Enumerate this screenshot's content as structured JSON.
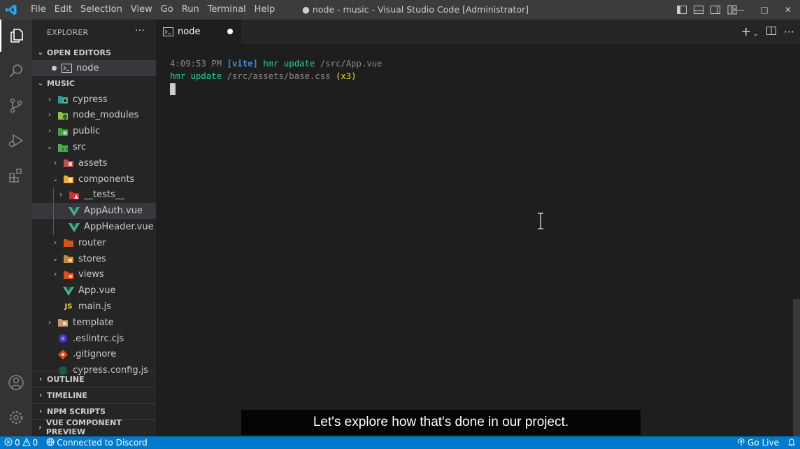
{
  "titlebar": {
    "logo_icon": "vscode-logo",
    "menu": [
      "File",
      "Edit",
      "Selection",
      "View",
      "Go",
      "Run",
      "Terminal",
      "Help"
    ],
    "window_title": "● node - music - Visual Studio Code [Administrator]"
  },
  "activity_bar": [
    "explorer-icon",
    "search-icon",
    "source-control-icon",
    "run-debug-icon",
    "extensions-icon",
    "accounts-icon",
    "manage-gear-icon"
  ],
  "sidebar": {
    "title": "EXPLORER",
    "more": "···",
    "open_editors": {
      "title": "OPEN EDITORS",
      "items": [
        {
          "label": "node",
          "icon": "terminal-icon"
        }
      ]
    },
    "folder": {
      "title": "MUSIC",
      "items": [
        {
          "label": "cypress"
        },
        {
          "label": "node_modules"
        },
        {
          "label": "public"
        },
        {
          "label": "src"
        },
        {
          "label": "assets"
        },
        {
          "label": "components"
        },
        {
          "label": "__tests__"
        },
        {
          "label": "AppAuth.vue"
        },
        {
          "label": "AppHeader.vue"
        },
        {
          "label": "router"
        },
        {
          "label": "stores"
        },
        {
          "label": "views"
        },
        {
          "label": "App.vue"
        },
        {
          "label": "main.js"
        },
        {
          "label": "template"
        },
        {
          "label": ".eslintrc.cjs"
        },
        {
          "label": ".gitignore"
        },
        {
          "label": "cypress.config.js"
        }
      ]
    },
    "bottom_sections": [
      "OUTLINE",
      "TIMELINE",
      "NPM SCRIPTS",
      "VUE COMPONENT PREVIEW"
    ]
  },
  "editor": {
    "tab_label": "node",
    "terminal": {
      "line1": {
        "time": "4:09:53 PM",
        "tag": "[vite]",
        "action": "hmr update",
        "path": "/src/App.vue"
      },
      "line2": {
        "action": "hmr update",
        "path": "/src/assets/base.css",
        "count": "(x3)"
      }
    }
  },
  "caption": "Let's explore how that's done in our project.",
  "statusbar": {
    "errors": "0",
    "warnings": "0",
    "discord": "Connected to Discord",
    "go_live": "Go Live"
  },
  "colors": {
    "statusbar": "#007acc",
    "titlebar": "#3c3c3c",
    "activitybar": "#333333",
    "sidebar": "#252526",
    "editor": "#1e1e1e",
    "vue_green": "#41b883",
    "js_yellow": "#f1dd3f"
  }
}
